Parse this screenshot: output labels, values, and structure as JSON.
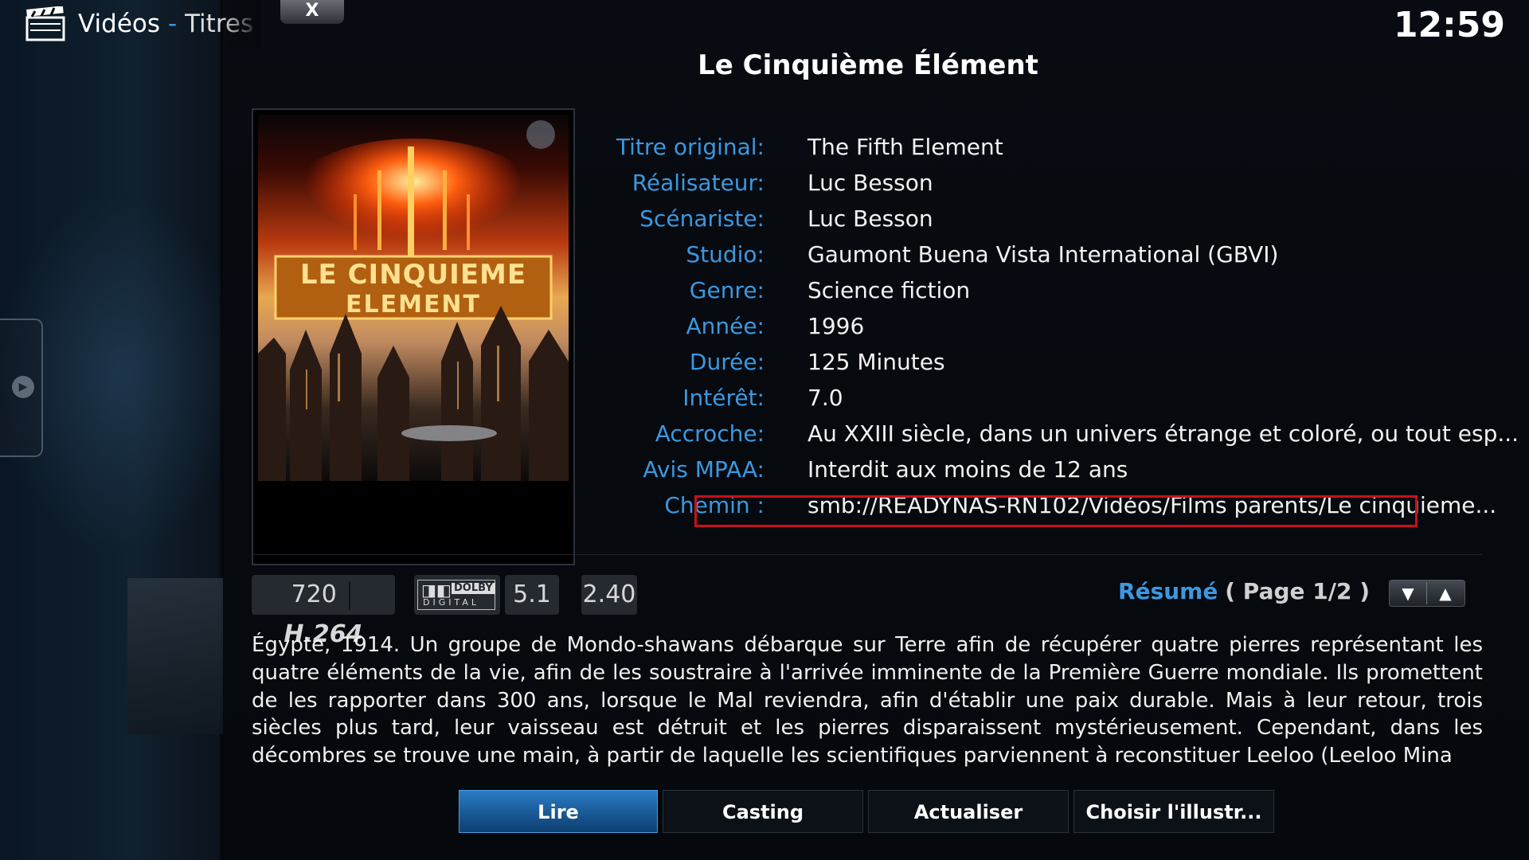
{
  "header": {
    "section": "Vidéos",
    "separator": "-",
    "subtitle": "Titres"
  },
  "close_label": "X",
  "clock": "12:59",
  "movie": {
    "title": "Le Cinquième Élément",
    "poster_text": "LE CINQUIEME ELEMENT"
  },
  "details": [
    {
      "label": "Titre original:",
      "value": "The Fifth Element"
    },
    {
      "label": "Réalisateur:",
      "value": "Luc Besson"
    },
    {
      "label": "Scénariste:",
      "value": "Luc Besson"
    },
    {
      "label": "Studio:",
      "value": "Gaumont Buena Vista International (GBVI)"
    },
    {
      "label": "Genre:",
      "value": "Science fiction"
    },
    {
      "label": "Année:",
      "value": "1996"
    },
    {
      "label": "Durée:",
      "value": "125 Minutes"
    },
    {
      "label": "Intérêt:",
      "value": "7.0"
    },
    {
      "label": "Accroche:",
      "value": "Au XXIII siècle, dans un univers étrange et coloré, ou tout esp..."
    },
    {
      "label": "Avis MPAA:",
      "value": "Interdit aux moins de 12 ans"
    },
    {
      "label": "Chemin :",
      "value": "smb://READYNAS-RN102/Vidéos/Films parents/Le cinquieme..."
    }
  ],
  "flags": {
    "resolution": "720",
    "codec": "H.264",
    "audio_brand": "DOLBY",
    "audio_sub": "DIGITAL",
    "channels": "5.1",
    "aspect": "2.40"
  },
  "summary": {
    "label": "Résumé",
    "page": "( Page 1/2 )",
    "plot": "Égypte, 1914. Un groupe de Mondo-shawans débarque sur Terre afin de récupérer quatre pierres représentant les quatre éléments de la vie, afin de les soustraire à l'arrivée imminente de la Première Guerre mondiale. Ils promettent de les rapporter dans 300 ans, lorsque le Mal reviendra, afin d'établir une paix durable. Mais à leur retour, trois siècles plus tard, leur vaisseau est détruit et les pierres disparaissent mystérieusement. Cependant, dans les décombres se trouve une main, à partir de laquelle les scientifiques parviennent à reconstituer Leeloo (Leeloo Mina"
  },
  "buttons": {
    "play": "Lire",
    "cast": "Casting",
    "refresh": "Actualiser",
    "choose_art": "Choisir l'illustr..."
  },
  "colors": {
    "accent": "#3b98e0",
    "highlight_border": "#c8101a",
    "selected_button": "#1b5f9e"
  }
}
